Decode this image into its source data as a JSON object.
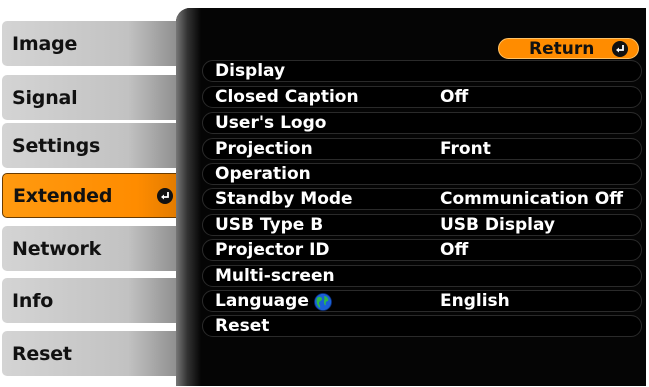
{
  "left_menu": {
    "items": [
      {
        "label": "Image",
        "active": false
      },
      {
        "label": "Signal",
        "active": false
      },
      {
        "label": "Settings",
        "active": false
      },
      {
        "label": "Extended",
        "active": true
      },
      {
        "label": "Network",
        "active": false
      },
      {
        "label": "Info",
        "active": false
      },
      {
        "label": "Reset",
        "active": false
      }
    ]
  },
  "panel": {
    "return_label": "Return",
    "rows": [
      {
        "label": "Display",
        "value": ""
      },
      {
        "label": "Closed Caption",
        "value": "Off"
      },
      {
        "label": "User's Logo",
        "value": ""
      },
      {
        "label": "Projection",
        "value": "Front"
      },
      {
        "label": "Operation",
        "value": ""
      },
      {
        "label": "Standby Mode",
        "value": "Communication Off"
      },
      {
        "label": "USB Type B",
        "value": "USB Display"
      },
      {
        "label": "Projector ID",
        "value": "Off"
      },
      {
        "label": "Multi-screen",
        "value": ""
      },
      {
        "label": "Language",
        "value": "English"
      },
      {
        "label": "Reset",
        "value": ""
      }
    ]
  },
  "icons": {
    "enter": "enter-icon",
    "globe": "globe-icon"
  },
  "colors": {
    "accent_orange": "#ff8c00",
    "menu_gray": "#c2c2c2",
    "panel_black": "#050505",
    "text_white": "#ffffff",
    "globe_green": "#2db84a",
    "globe_blue": "#1a5fd6"
  }
}
